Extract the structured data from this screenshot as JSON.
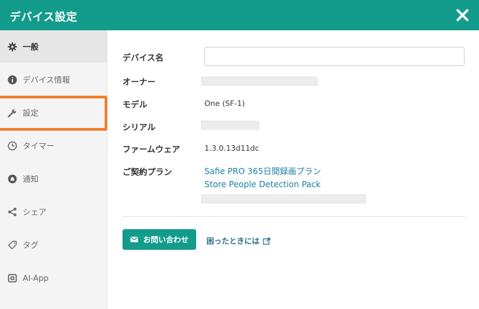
{
  "window": {
    "title": "デバイス設定"
  },
  "sidebar": {
    "items": [
      {
        "label": "一般",
        "icon": "gear-icon"
      },
      {
        "label": "デバイス情報",
        "icon": "info-icon"
      },
      {
        "label": "設定",
        "icon": "wrench-icon"
      },
      {
        "label": "タイマー",
        "icon": "clock-icon"
      },
      {
        "label": "通知",
        "icon": "bell-icon"
      },
      {
        "label": "シェア",
        "icon": "share-icon"
      },
      {
        "label": "タグ",
        "icon": "tag-icon"
      },
      {
        "label": "AI-App",
        "icon": "ai-app-icon"
      }
    ]
  },
  "details": {
    "device_name_label": "デバイス名",
    "device_name_value": "",
    "owner_label": "オーナー",
    "model_label": "モデル",
    "model_value": "One (SF-1)",
    "serial_label": "シリアル",
    "firmware_label": "ファームウェア",
    "firmware_value": "1.3.0.13d11dc",
    "contract_label": "ご契約プラン",
    "plans": [
      "Safie PRO 365日間録画プラン",
      "Store People Detection Pack"
    ]
  },
  "actions": {
    "contact_label": "お問い合わせ",
    "help_label": "困ったときには"
  },
  "colors": {
    "accent": "#139b8c",
    "highlight": "#f07f2e",
    "link": "#1a7fa0"
  }
}
